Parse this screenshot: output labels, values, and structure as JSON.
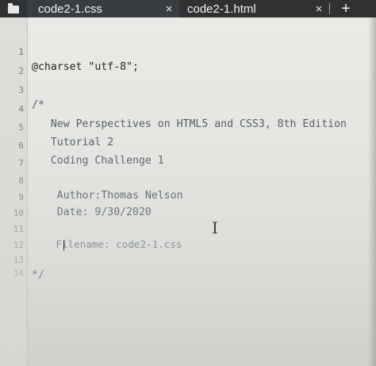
{
  "tabs": [
    {
      "label": "code2-1.css",
      "close": "×",
      "active": true
    },
    {
      "label": "code2-1.html",
      "close": "×",
      "active": false
    }
  ],
  "new_tab_label": "+",
  "icons": {
    "files": "folder-icon",
    "cursor": "text-cursor-icon"
  },
  "colors": {
    "tabbar_bg": "#2f3133",
    "editor_bg": "#e6e7e3",
    "code_text": "#2e2e2e",
    "comment_text": "#5f6870",
    "line_number": "#7d7f7f"
  },
  "editor": {
    "lines": [
      {
        "number": "1",
        "text": "@charset \"utf-8\";"
      },
      {
        "number": "2",
        "text": ""
      },
      {
        "number": "3",
        "text": "/*"
      },
      {
        "number": "4",
        "text": "   New Perspectives on HTML5 and CSS3, 8th Edition"
      },
      {
        "number": "5",
        "text": "   Tutorial 2"
      },
      {
        "number": "6",
        "text": "   Coding Challenge 1"
      },
      {
        "number": "7",
        "text": ""
      },
      {
        "number": "8",
        "text": "    Author:Thomas Nelson"
      },
      {
        "number": "9",
        "text": "    Date: 9/30/2020"
      },
      {
        "number": "10",
        "text": ""
      },
      {
        "number": "11",
        "text": "    Filename: code2-1.css"
      },
      {
        "number": "12",
        "text": ""
      },
      {
        "number": "13",
        "text": "*/"
      },
      {
        "number": "14",
        "text": ""
      }
    ]
  }
}
